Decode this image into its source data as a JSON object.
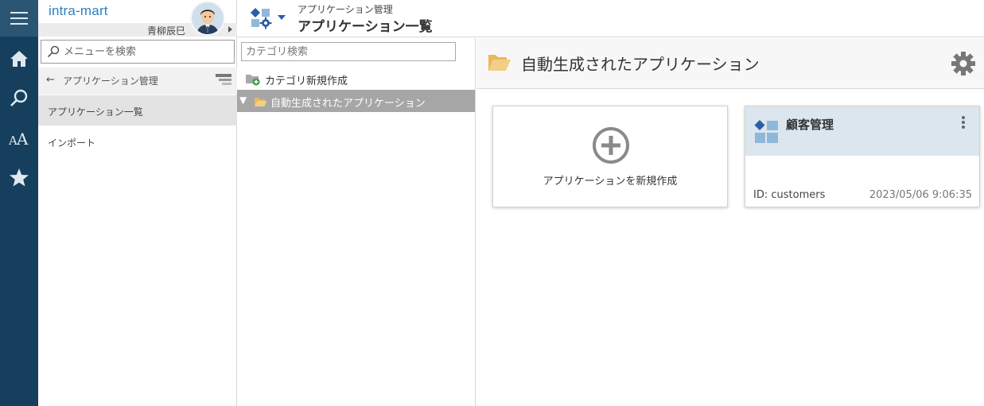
{
  "sidebar_rail": {
    "items": [
      "menu-icon",
      "home-icon",
      "search-icon",
      "font-size-icon",
      "star-icon"
    ]
  },
  "menu_panel": {
    "logo": "intra-mart",
    "user_name": "青柳辰巳",
    "search_placeholder": "メニューを検索",
    "back_label": "アプリケーション管理",
    "items": [
      {
        "label": "アプリケーション一覧",
        "active": true
      },
      {
        "label": "インポート",
        "active": false
      }
    ]
  },
  "header": {
    "breadcrumb": "アプリケーション管理",
    "title": "アプリケーション一覧"
  },
  "category": {
    "search_placeholder": "カテゴリ検索",
    "new_label": "カテゴリ新規作成",
    "selected": "自動生成されたアプリケーション"
  },
  "main": {
    "title": "自動生成されたアプリケーション",
    "new_card_label": "アプリケーションを新規作成",
    "app": {
      "name": "顧客管理",
      "id": "ID: customers",
      "updated": "2023/05/06 9:06:35"
    }
  },
  "colors": {
    "rail": "#163f5e",
    "accent": "#2e7fc2",
    "folder": "#efc577",
    "selected_row": "#a6a6a6",
    "app_card_header": "#dbe6ee"
  }
}
